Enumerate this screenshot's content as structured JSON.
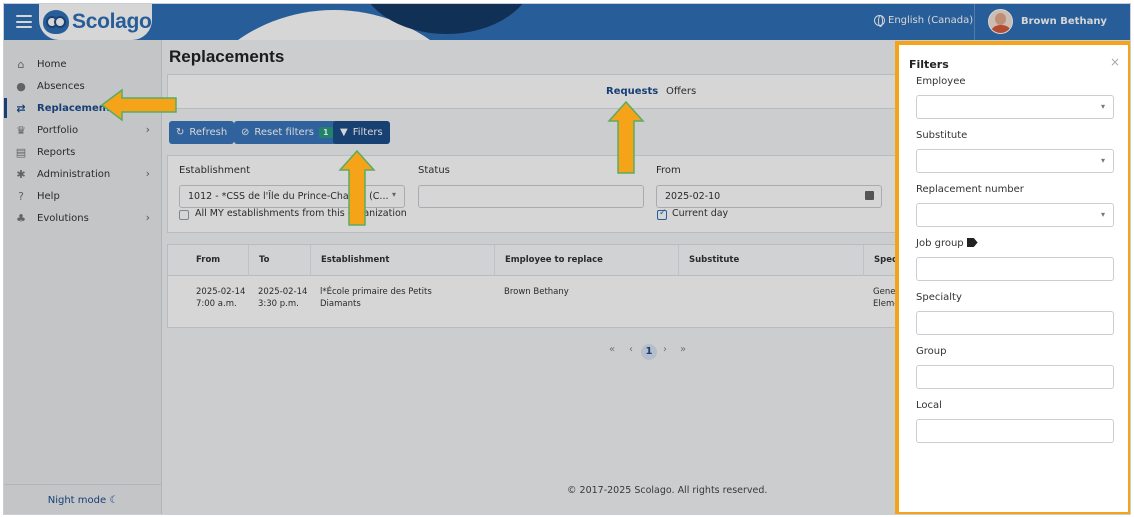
{
  "header": {
    "logo": "Scolago",
    "language": "English (Canada)",
    "user_name": "Brown Bethany"
  },
  "sidebar": {
    "items": [
      {
        "label": "Home",
        "icon": "house-icon"
      },
      {
        "label": "Absences",
        "icon": "person-clock-icon"
      },
      {
        "label": "Replacements",
        "icon": "swap-icon",
        "active": true
      },
      {
        "label": "Portfolio",
        "icon": "trophy-icon",
        "has_submenu": true
      },
      {
        "label": "Reports",
        "icon": "document-icon"
      },
      {
        "label": "Administration",
        "icon": "gear-icon",
        "has_submenu": true
      },
      {
        "label": "Help",
        "icon": "question-icon"
      },
      {
        "label": "Evolutions",
        "icon": "sprout-icon",
        "has_submenu": true
      }
    ],
    "night_mode": "Night mode"
  },
  "page": {
    "title": "Replacements",
    "tabs": [
      {
        "label": "Requests",
        "active": true
      },
      {
        "label": "Offers",
        "active": false
      }
    ],
    "toolbar": {
      "refresh": "Refresh",
      "reset_filters": "Reset filters",
      "reset_badge": "1",
      "filters": "Filters"
    },
    "filters": {
      "establishment_label": "Establishment",
      "establishment_value": "1012 - *CSS de l'Île du Prince-Charles (C...",
      "all_my_establishments": "All MY establishments from this organization",
      "all_my_checked": false,
      "status_label": "Status",
      "status_value": "",
      "from_label": "From",
      "from_value": "2025-02-10",
      "current_day": "Current day",
      "current_day_checked": true
    },
    "table": {
      "columns": [
        "From",
        "To",
        "Establishment",
        "Employee to replace",
        "Substitute",
        "Specia"
      ],
      "rows": [
        {
          "from_date": "2025-02-14",
          "from_time": "7:00 a.m.",
          "to_date": "2025-02-14",
          "to_time": "3:30 p.m.",
          "establishment_1": "l*École primaire des Petits",
          "establishment_2": "Diamants",
          "employee": "Brown Bethany",
          "substitute": "",
          "specialty_1": "Genera",
          "specialty_2": "Eleme"
        }
      ]
    },
    "pagination": {
      "first": "«",
      "prev": "‹",
      "current": "1",
      "next": "›",
      "last": "»"
    },
    "footer": "© 2017-2025 Scolago. All rights reserved."
  },
  "drawer": {
    "title": "Filters",
    "close": "×",
    "fields": [
      {
        "label": "Employee",
        "type": "select",
        "value": ""
      },
      {
        "label": "Substitute",
        "type": "select",
        "value": ""
      },
      {
        "label": "Replacement number",
        "type": "select",
        "value": ""
      },
      {
        "label": "Job group",
        "type": "text",
        "value": "",
        "icon": "tag-icon"
      },
      {
        "label": "Specialty",
        "type": "text",
        "value": ""
      },
      {
        "label": "Group",
        "type": "text",
        "value": ""
      },
      {
        "label": "Local",
        "type": "text",
        "value": ""
      }
    ]
  },
  "colors": {
    "header_blue": "#2f6fb6",
    "nav_active": "#1b4c8c",
    "annotation_orange": "#f5a319",
    "badge_green": "#2a9d7f"
  }
}
